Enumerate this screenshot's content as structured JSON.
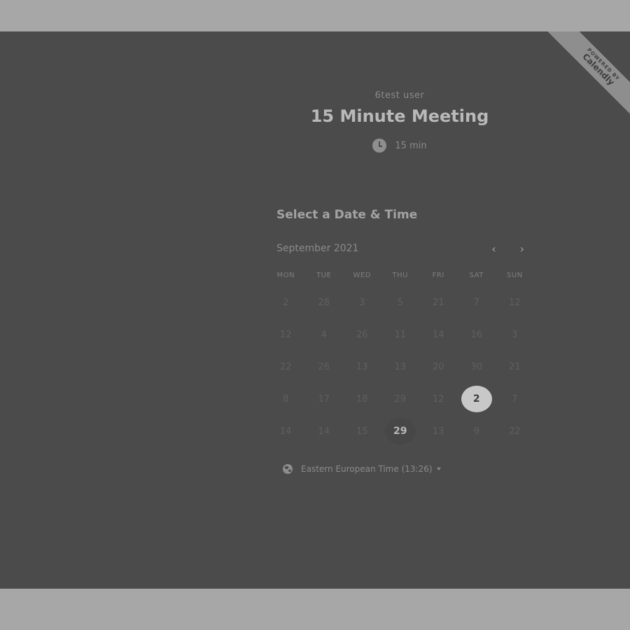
{
  "ribbon": {
    "line1": "POWERED BY",
    "line2": "Calendly"
  },
  "event": {
    "host": "6test user",
    "title": "15 Minute Meeting",
    "duration": "15 min",
    "duration_icon": "clock-icon"
  },
  "calendar": {
    "section_title": "Select a Date & Time",
    "month_label": "September 2021",
    "prev_icon": "‹",
    "next_icon": "›",
    "weekdays": [
      "MON",
      "TUE",
      "WED",
      "THU",
      "FRI",
      "SAT",
      "SUN"
    ],
    "weeks": [
      [
        "2",
        "28",
        "3",
        "5",
        "21",
        "7",
        "12"
      ],
      [
        "12",
        "4",
        "26",
        "11",
        "14",
        "16",
        "3"
      ],
      [
        "22",
        "26",
        "13",
        "13",
        "20",
        "30",
        "21"
      ],
      [
        "8",
        "17",
        "18",
        "29",
        "12",
        "2",
        "7"
      ],
      [
        "14",
        "14",
        "15",
        "29",
        "13",
        "9",
        "22"
      ]
    ],
    "selected_day": "2",
    "today_day": "29",
    "timezone": "Eastern European Time (13:26)",
    "timezone_icon": "globe-icon"
  }
}
